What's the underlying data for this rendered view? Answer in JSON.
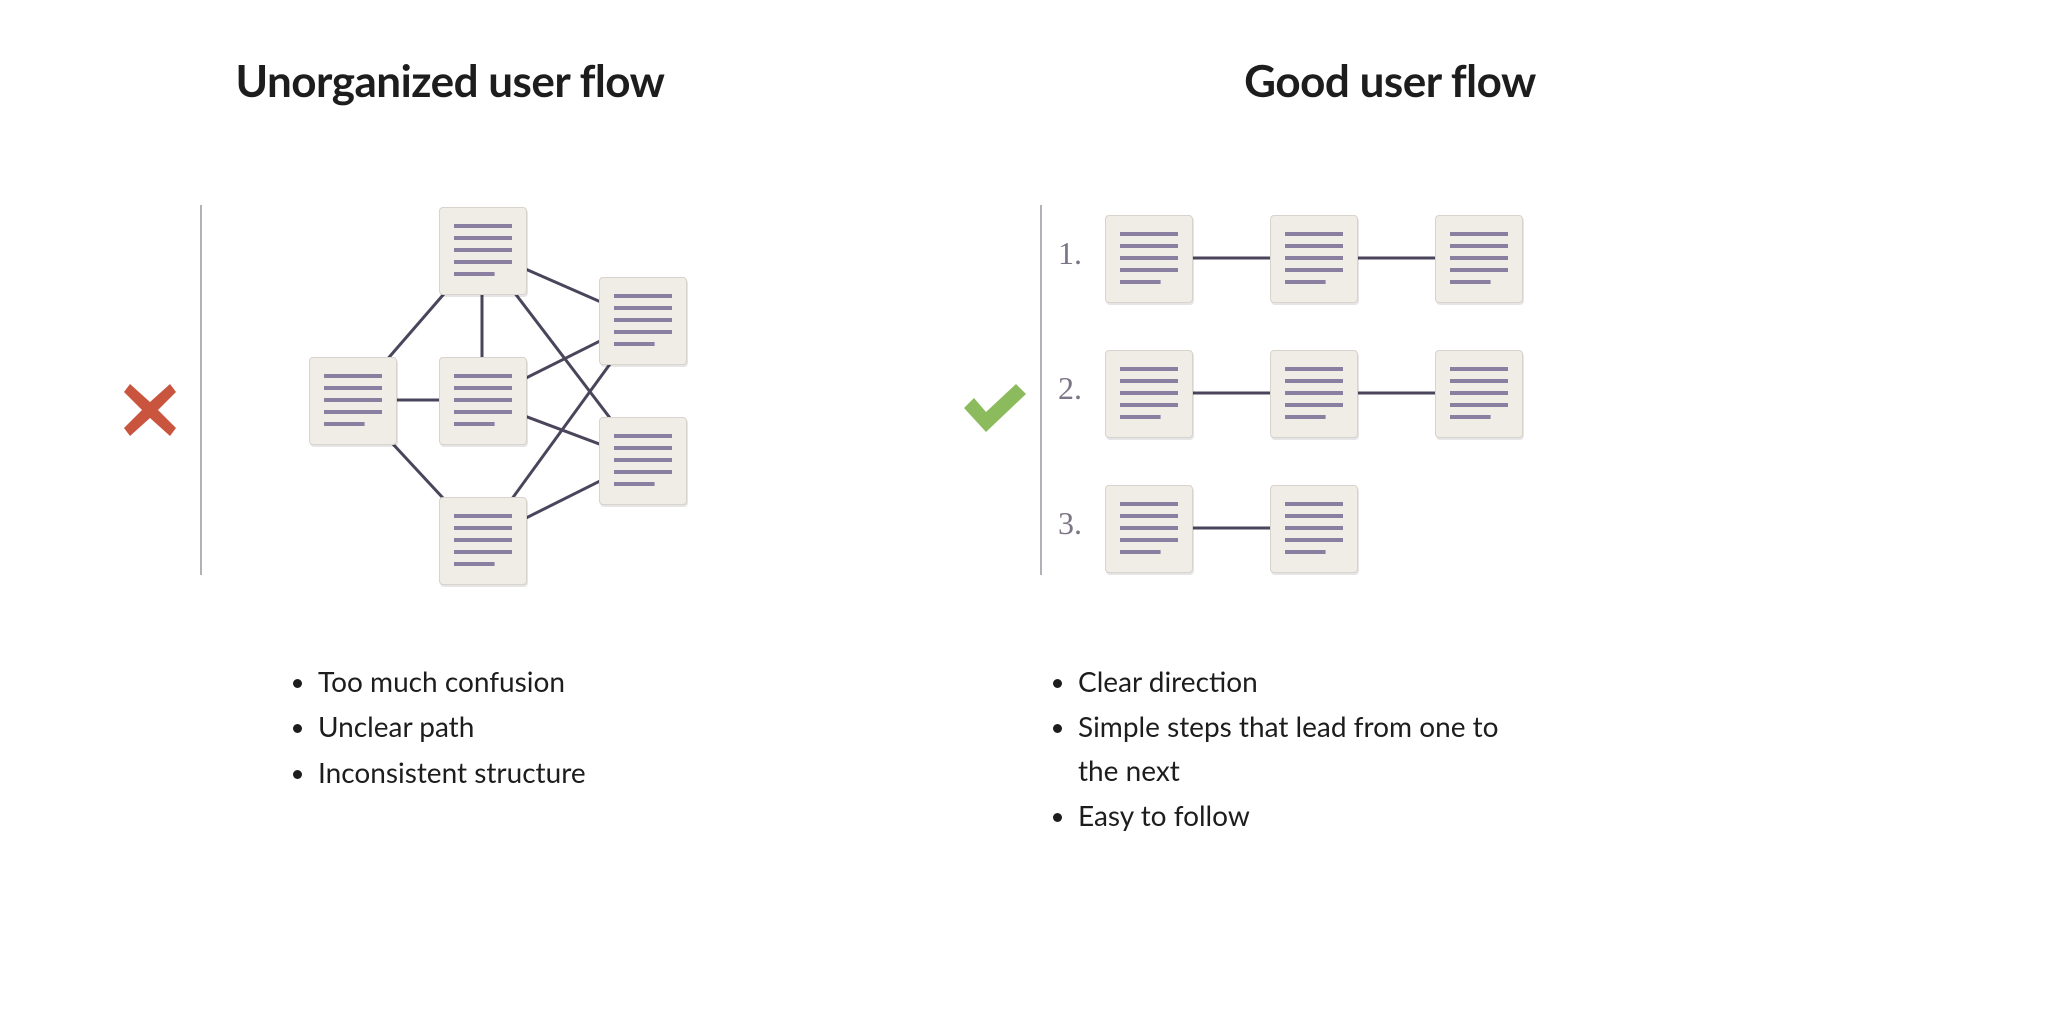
{
  "left": {
    "title": "Unorganized user flow",
    "icon": "cross",
    "bullets": [
      "Too much confusion",
      "Unclear path",
      "Inconsistent structure"
    ]
  },
  "right": {
    "title": "Good user flow",
    "icon": "check",
    "rows": [
      "1.",
      "2.",
      "3."
    ],
    "bullets": [
      "Clear direction",
      "Simple steps that lead from one to the next",
      "Easy to follow"
    ]
  },
  "colors": {
    "cross": "#c9553f",
    "check": "#8cbb5e",
    "line": "#4b455c",
    "card": "#f0ece6"
  }
}
